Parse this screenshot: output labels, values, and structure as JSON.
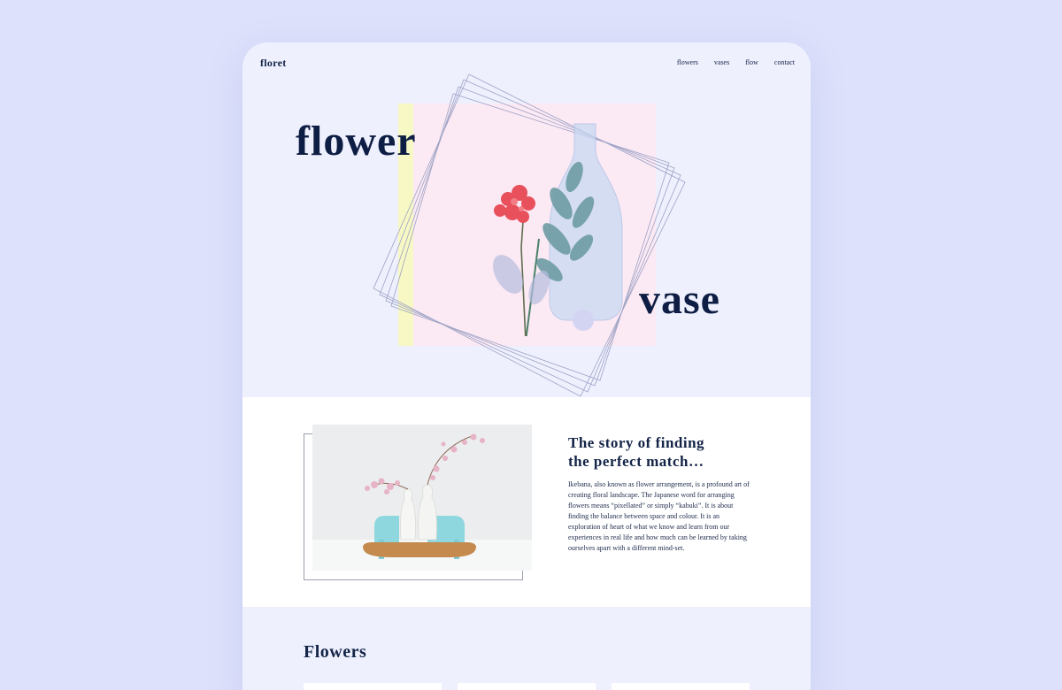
{
  "brand": {
    "logo": "floret"
  },
  "nav": {
    "items": [
      "flowers",
      "vases",
      "flow",
      "contact"
    ]
  },
  "hero": {
    "word_left": "flower",
    "word_right": "vase"
  },
  "story": {
    "title_line1": "The story of finding",
    "title_line2": "the perfect match…",
    "body": "Ikebana, also known as flower arrangement, is a profound art of creating floral landscape. The Japanese word for arranging flowers means “pixellated” or simply “kabuki”. It is about finding the balance between space and colour. It is an exploration of heart of what we know and learn from our experiences in real life and how much can be learned by taking ourselves apart with a different mind-set."
  },
  "flowers": {
    "title": "Flowers"
  },
  "colors": {
    "page_bg": "#dde1fb",
    "device_bg": "#eef0fe",
    "ink": "#142447",
    "pink": "#fbe9f4",
    "yellow": "#f7f8c4"
  }
}
